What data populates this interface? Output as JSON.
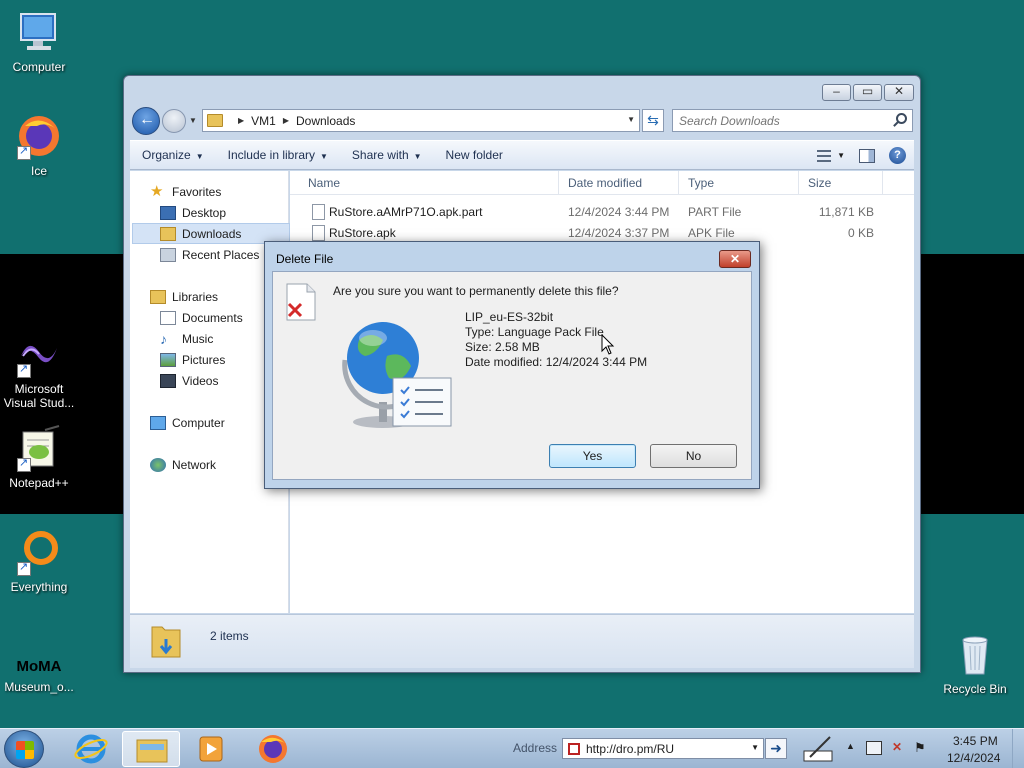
{
  "desktop": {
    "icons": [
      {
        "label": "Computer"
      },
      {
        "label": "Ice"
      },
      {
        "label": "Microsoft Visual Stud..."
      },
      {
        "label": "Notepad++"
      },
      {
        "label": "Everything"
      },
      {
        "label": "Museum_o..."
      },
      {
        "label": "Recycle Bin"
      }
    ],
    "moma_logo_text": "MoMA"
  },
  "explorer": {
    "caption_buttons": {
      "minimize": "▭",
      "maximize": "▭",
      "close": "✕"
    },
    "breadcrumb": [
      "VM1",
      "Downloads"
    ],
    "search_placeholder": "Search Downloads",
    "toolbar": {
      "organize": "Organize",
      "include_in_library": "Include in library",
      "share_with": "Share with",
      "new_folder": "New folder"
    },
    "nav": {
      "favorites": "Favorites",
      "desktop": "Desktop",
      "downloads": "Downloads",
      "recent_places": "Recent Places",
      "libraries": "Libraries",
      "documents": "Documents",
      "music": "Music",
      "pictures": "Pictures",
      "videos": "Videos",
      "computer": "Computer",
      "network": "Network"
    },
    "columns": {
      "name": "Name",
      "date_modified": "Date modified",
      "type": "Type",
      "size": "Size"
    },
    "files": [
      {
        "name": "RuStore.aAMrP71O.apk.part",
        "date": "12/4/2024 3:44 PM",
        "type": "PART File",
        "size": "11,871 KB"
      },
      {
        "name": "RuStore.apk",
        "date": "12/4/2024 3:37 PM",
        "type": "APK File",
        "size": "0 KB"
      }
    ],
    "status": "2 items"
  },
  "dialog": {
    "title": "Delete File",
    "question": "Are you sure you want to permanently delete this file?",
    "file_name": "LIP_eu-ES-32bit",
    "file_type": "Type: Language Pack File",
    "file_size": "Size: 2.58 MB",
    "file_date": "Date modified: 12/4/2024 3:44 PM",
    "yes": "Yes",
    "no": "No",
    "close": "✕"
  },
  "taskbar": {
    "address_label": "Address",
    "address_value": "http://dro.pm/RU",
    "time": "3:45 PM",
    "date": "12/4/2024"
  },
  "colors": {
    "desktop_teal": "#11706f",
    "taskbar": "#bcd0e6",
    "dialog_frame": "#bed3ea"
  }
}
